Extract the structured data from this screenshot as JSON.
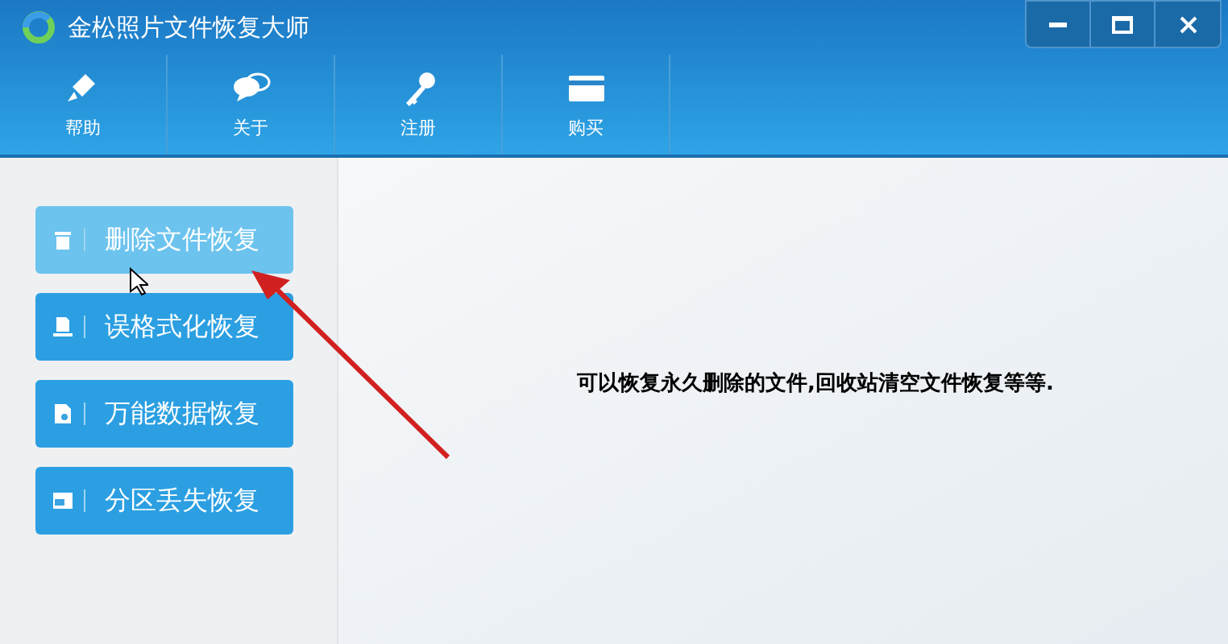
{
  "window": {
    "title": "金松照片文件恢复大师"
  },
  "toolbar": [
    {
      "kind": "help",
      "label": "帮助"
    },
    {
      "kind": "about",
      "label": "关于"
    },
    {
      "kind": "register",
      "label": "注册"
    },
    {
      "kind": "buy",
      "label": "购买"
    }
  ],
  "sidebar": {
    "items": [
      {
        "kind": "trash",
        "label": "删除文件恢复",
        "selected": true
      },
      {
        "kind": "format",
        "label": "误格式化恢复",
        "selected": false
      },
      {
        "kind": "universal",
        "label": "万能数据恢复",
        "selected": false
      },
      {
        "kind": "partition",
        "label": "分区丢失恢复",
        "selected": false
      }
    ]
  },
  "description": "可以恢复永久删除的文件,回收站清空文件恢复等等."
}
